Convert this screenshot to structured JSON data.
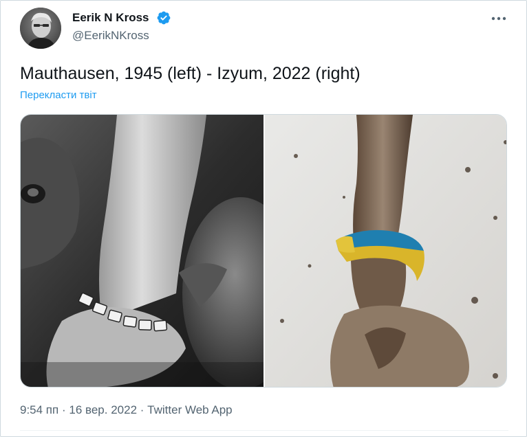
{
  "author": {
    "name": "Eerik N Kross",
    "handle": "@EerikNKross",
    "verified": true,
    "avatar_icon": "profile-photo"
  },
  "tweet": {
    "text": "Mauthausen, 1945 (left) - Izyum, 2022 (right)",
    "translate_label": "Перекласти твіт",
    "time": "9:54 пп",
    "separator": "·",
    "date": "16 вер. 2022",
    "source": "Twitter Web App"
  },
  "media": {
    "images": [
      {
        "icon": "photo-left",
        "style": "black-and-white"
      },
      {
        "icon": "photo-right",
        "style": "color"
      }
    ]
  },
  "colors": {
    "link": "#1d9bf0",
    "verified": "#1d9bf0",
    "secondary_text": "#536471",
    "primary_text": "#0f1419"
  }
}
